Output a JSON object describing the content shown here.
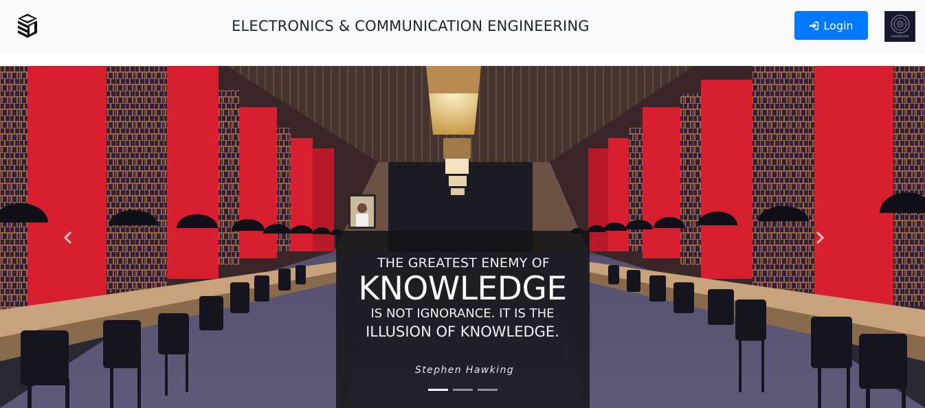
{
  "header": {
    "title": "ELECTRONICS & COMMUNICATION ENGINEERING",
    "login_label": "Login",
    "brand_icon": "stacked-cubes-icon",
    "login_icon": "sign-in-icon",
    "college_logo_text": "KUMARAGURU"
  },
  "carousel": {
    "quote": {
      "line1": "THE GREATEST ENEMY OF",
      "line2": "KNOWLEDGE",
      "line3": "IS NOT IGNORANCE. IT IS THE",
      "line4": "ILLUSION OF KNOWLEDGE.",
      "author": "Stephen Hawking"
    },
    "slide_count": 3,
    "active_slide": 0,
    "prev_icon": "chevron-left-icon",
    "next_icon": "chevron-right-icon"
  },
  "colors": {
    "navbar_bg": "#f8f9fa",
    "login_button": "#007bff",
    "wall_red": "#d81f30",
    "quote_panel": "#121216"
  }
}
